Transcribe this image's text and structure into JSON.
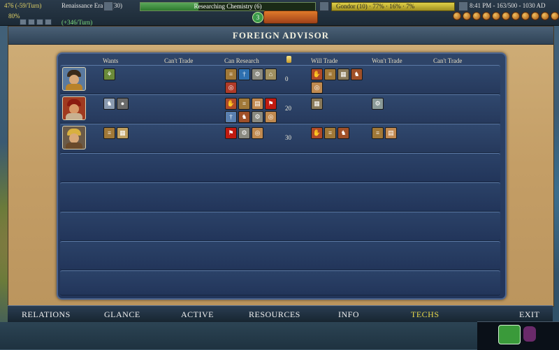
{
  "hud": {
    "gold_info": "476 (-59/Turn)",
    "era": "Renaissance Era",
    "research_count": "(30)",
    "research_label": "Researching Chemistry (6)",
    "research_progress": 0.33,
    "gold_bar_label": "Gondor (10) · 77% · 16% · 7%",
    "time_info": "8:41 PM - 163/500 - 1030 AD",
    "happy_info": "80%",
    "income_info": "(+346/Turn)",
    "city_badge": "3"
  },
  "window": {
    "title": "FOREIGN ADVISOR"
  },
  "columns": {
    "wants": "Wants",
    "cant_trade_1": "Can't Trade",
    "can_research": "Can Research",
    "will_trade": "Will Trade",
    "wont_trade": "Won't Trade",
    "cant_trade_2": "Can't Trade"
  },
  "leaders": [
    {
      "portrait": "leader-portrait-asian",
      "colors": {
        "bg": "#5a7aa0",
        "hat": "#3a2a1a",
        "face": "#d8a878",
        "body": "#b8822a"
      },
      "wants": [
        {
          "icon": "farm-tech-icon",
          "color": "#6a8a3a"
        }
      ],
      "can_research": [
        {
          "icon": "scroll-tech-icon",
          "color": "#a07838"
        },
        {
          "icon": "blue-figure-tech-icon",
          "color": "#2e70b0"
        },
        {
          "icon": "gears-tech-icon",
          "color": "#8a8a80"
        },
        {
          "icon": "building-tech-icon",
          "color": "#a09060"
        },
        {
          "icon": "compass-tech-icon",
          "color": "#b03a28"
        }
      ],
      "gold": "0",
      "will_trade": [
        {
          "icon": "hands-tech-icon",
          "color": "#b04a28"
        },
        {
          "icon": "scroll-tech-icon",
          "color": "#a07838"
        },
        {
          "icon": "map-tech-icon",
          "color": "#8a7a5a"
        },
        {
          "icon": "horse-tech-icon",
          "color": "#a05028"
        },
        {
          "icon": "compass-tech-icon",
          "color": "#c08a50"
        }
      ],
      "wont_trade": [],
      "cant_trade": []
    },
    {
      "portrait": "leader-portrait-red",
      "colors": {
        "bg": "#a03a20",
        "hat": "#8a1a10",
        "face": "#d89868",
        "body": "#c8b090"
      },
      "wants": [
        {
          "icon": "rider-tech-icon",
          "color": "#8a9ab0"
        },
        {
          "icon": "circle-tech-icon",
          "color": "#6a6a6a"
        }
      ],
      "can_research": [
        {
          "icon": "hands-tech-icon",
          "color": "#b04a28"
        },
        {
          "icon": "scroll-tech-icon",
          "color": "#a07838"
        },
        {
          "icon": "book-tech-icon",
          "color": "#c08850"
        },
        {
          "icon": "flag-tech-icon",
          "color": "#c01a10"
        },
        {
          "icon": "blue-figure-tech-icon",
          "color": "#5a80b0"
        },
        {
          "icon": "horse-tech-icon",
          "color": "#a05028"
        },
        {
          "icon": "gears-tech-icon",
          "color": "#8a8a80"
        },
        {
          "icon": "compass-tech-icon",
          "color": "#c08a50"
        }
      ],
      "gold": "20",
      "will_trade": [
        {
          "icon": "map-tech-icon",
          "color": "#8a7a5a"
        }
      ],
      "wont_trade": [
        {
          "icon": "gears-tech-icon",
          "color": "#8a9a98"
        }
      ],
      "cant_trade": []
    },
    {
      "portrait": "leader-portrait-crowned",
      "colors": {
        "bg": "#6a5a48",
        "hat": "#d8b040",
        "face": "#d8a878",
        "body": "#6a4a2a"
      },
      "wants": [
        {
          "icon": "scroll-tech-icon",
          "color": "#a07838"
        },
        {
          "icon": "map-tech-icon",
          "color": "#c0a060"
        }
      ],
      "can_research": [
        {
          "icon": "flag-tech-icon",
          "color": "#c01a10"
        },
        {
          "icon": "gears-tech-icon",
          "color": "#8a8a80"
        },
        {
          "icon": "compass-tech-icon",
          "color": "#c08a50"
        }
      ],
      "gold": "30",
      "will_trade": [
        {
          "icon": "hands-tech-icon",
          "color": "#b04a28"
        },
        {
          "icon": "scroll-tech-icon",
          "color": "#a07838"
        },
        {
          "icon": "horse-tech-icon",
          "color": "#a05028"
        }
      ],
      "wont_trade": [
        {
          "icon": "scroll-tech-icon",
          "color": "#a07838"
        },
        {
          "icon": "book-tech-icon",
          "color": "#c08850"
        }
      ],
      "cant_trade": []
    }
  ],
  "tabs": [
    {
      "label": "RELATIONS",
      "active": false
    },
    {
      "label": "GLANCE",
      "active": false
    },
    {
      "label": "ACTIVE",
      "active": false
    },
    {
      "label": "RESOURCES",
      "active": false
    },
    {
      "label": "INFO",
      "active": false
    },
    {
      "label": "TECHS",
      "active": true
    },
    {
      "label": "EXIT",
      "active": false
    }
  ],
  "colors": {
    "active_tab": "#e8d84a",
    "panel_bg": "#2e4468",
    "parchment": "#c8a870"
  }
}
